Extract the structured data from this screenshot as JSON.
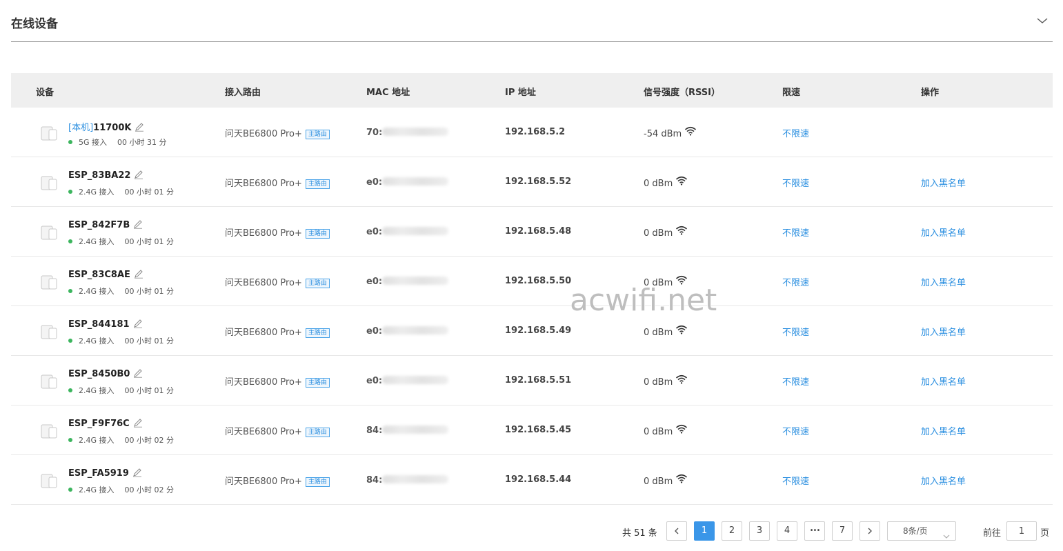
{
  "section": {
    "title": "在线设备"
  },
  "columns": {
    "device": "设备",
    "router": "接入路由",
    "mac": "MAC 地址",
    "ip": "IP 地址",
    "rssi": "信号强度（RSSI）",
    "limit": "限速",
    "action": "操作"
  },
  "devices": [
    {
      "local_tag": "[本机]",
      "name": "11700K",
      "band": "5G 接入",
      "duration": "00 小时 31 分",
      "router": "问天BE6800 Pro+",
      "router_badge": "主路由",
      "mac_prefix": "70:",
      "ip": "192.168.5.2",
      "rssi": "-54 dBm",
      "limit": "不限速",
      "action": ""
    },
    {
      "local_tag": "",
      "name": "ESP_83BA22",
      "band": "2.4G 接入",
      "duration": "00 小时 01 分",
      "router": "问天BE6800 Pro+",
      "router_badge": "主路由",
      "mac_prefix": "e0:",
      "ip": "192.168.5.52",
      "rssi": "0 dBm",
      "limit": "不限速",
      "action": "加入黑名单"
    },
    {
      "local_tag": "",
      "name": "ESP_842F7B",
      "band": "2.4G 接入",
      "duration": "00 小时 01 分",
      "router": "问天BE6800 Pro+",
      "router_badge": "主路由",
      "mac_prefix": "e0:",
      "ip": "192.168.5.48",
      "rssi": "0 dBm",
      "limit": "不限速",
      "action": "加入黑名单"
    },
    {
      "local_tag": "",
      "name": "ESP_83C8AE",
      "band": "2.4G 接入",
      "duration": "00 小时 01 分",
      "router": "问天BE6800 Pro+",
      "router_badge": "主路由",
      "mac_prefix": "e0:",
      "ip": "192.168.5.50",
      "rssi": "0 dBm",
      "limit": "不限速",
      "action": "加入黑名单"
    },
    {
      "local_tag": "",
      "name": "ESP_844181",
      "band": "2.4G 接入",
      "duration": "00 小时 01 分",
      "router": "问天BE6800 Pro+",
      "router_badge": "主路由",
      "mac_prefix": "e0:",
      "ip": "192.168.5.49",
      "rssi": "0 dBm",
      "limit": "不限速",
      "action": "加入黑名单"
    },
    {
      "local_tag": "",
      "name": "ESP_8450B0",
      "band": "2.4G 接入",
      "duration": "00 小时 01 分",
      "router": "问天BE6800 Pro+",
      "router_badge": "主路由",
      "mac_prefix": "e0:",
      "ip": "192.168.5.51",
      "rssi": "0 dBm",
      "limit": "不限速",
      "action": "加入黑名单"
    },
    {
      "local_tag": "",
      "name": "ESP_F9F76C",
      "band": "2.4G 接入",
      "duration": "00 小时 02 分",
      "router": "问天BE6800 Pro+",
      "router_badge": "主路由",
      "mac_prefix": "84:",
      "ip": "192.168.5.45",
      "rssi": "0 dBm",
      "limit": "不限速",
      "action": "加入黑名单"
    },
    {
      "local_tag": "",
      "name": "ESP_FA5919",
      "band": "2.4G 接入",
      "duration": "00 小时 02 分",
      "router": "问天BE6800 Pro+",
      "router_badge": "主路由",
      "mac_prefix": "84:",
      "ip": "192.168.5.44",
      "rssi": "0 dBm",
      "limit": "不限速",
      "action": "加入黑名单"
    }
  ],
  "pagination": {
    "total": "共 51 条",
    "pages": [
      "1",
      "2",
      "3",
      "4",
      "•••",
      "7"
    ],
    "current": "1",
    "page_size": "8条/页",
    "goto_label": "前往",
    "goto_value": "1",
    "goto_unit": "页"
  },
  "watermark": "acwifi.net",
  "icons": {
    "collapse": "chevron-down-icon",
    "device": "device-icon",
    "edit": "edit-pencil-icon",
    "wifi": "wifi-signal-icon",
    "prev": "chevron-left-icon",
    "next": "chevron-right-icon"
  },
  "colors": {
    "link": "#2b8fe0",
    "active_page": "#3a96e8",
    "online_dot": "#3cb55e",
    "header_bg": "#efefef"
  }
}
